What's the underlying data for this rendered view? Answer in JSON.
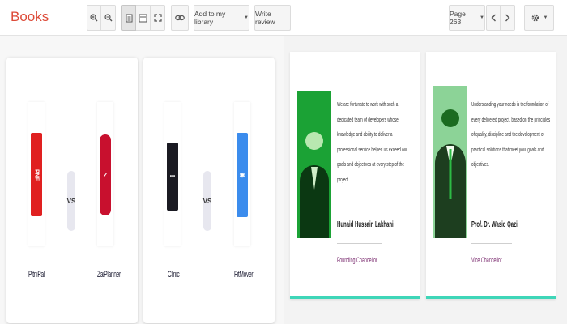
{
  "app": {
    "title": "Books"
  },
  "toolbar": {
    "icons": [
      "zoom-in-icon",
      "zoom-out-icon",
      "single-page-icon",
      "two-page-icon",
      "fullscreen-icon",
      "link-icon",
      "settings-gear-icon"
    ],
    "add_to_library_label": "Add to my library",
    "write_review_label": "Write review",
    "page_label": "Page 263"
  },
  "clients": [
    {
      "left": {
        "name": "PitniPal",
        "color": "#e02020",
        "glyph": "PNF"
      },
      "right": {
        "name": "ZaiPlanner",
        "color": "#c8102e",
        "glyph": "Z"
      },
      "vs": "VS"
    },
    {
      "left": {
        "name": "Clinic",
        "color": "#1a1a22",
        "glyph": "•••"
      },
      "right": {
        "name": "FitMover",
        "color": "#3b8ced",
        "glyph": "✱"
      },
      "vs": "VS"
    }
  ],
  "profiles": [
    {
      "quote": "We are fortunate to work with such a dedicated team of developers whose knowledge and ability to deliver a professional service helped us exceed our goals and objectives at every step of the project.",
      "name": "Hunaid Hussain Lakhani",
      "role": "Founding Chancellor"
    },
    {
      "quote": "Understanding your needs is the foundation of every delivered project, based on the principles of quality, discipline and the development of practical solutions that meet your goals and objectives.",
      "name": "Prof. Dr. Wasiq Qazi",
      "role": "Vice Chancellor"
    }
  ],
  "colors": {
    "brand": "#dd4b39",
    "accent_line": "#3fd6b8",
    "photo_tint": "#1fae3a"
  }
}
